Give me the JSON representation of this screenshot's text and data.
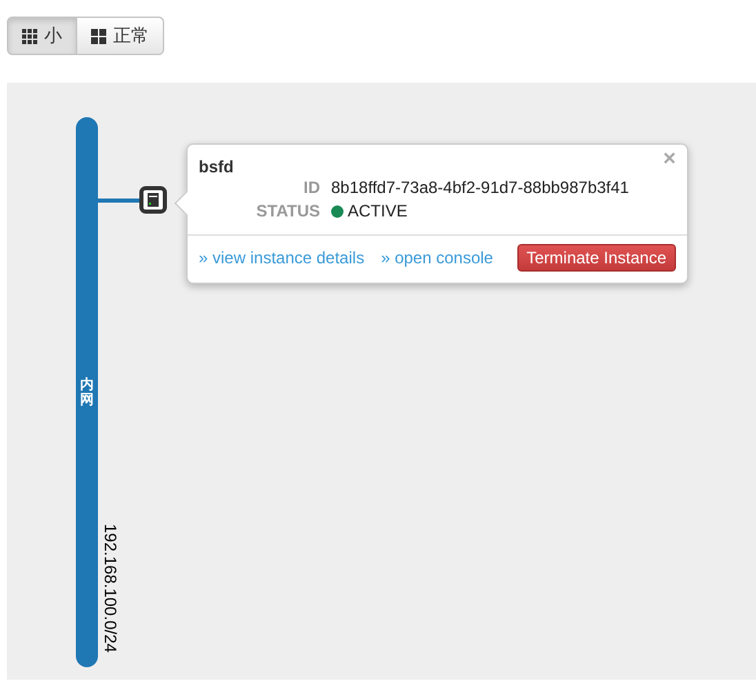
{
  "view_toggle": [
    {
      "label": "小",
      "selected": true,
      "kind": "small"
    },
    {
      "label": "正常",
      "selected": false,
      "kind": "normal"
    }
  ],
  "network": {
    "name": "内网",
    "cidr": "192.168.100.0/24"
  },
  "instance_popup": {
    "name": "bsfd",
    "close": "×",
    "fields": [
      {
        "label": "ID",
        "value": "8b18ffd7-73a8-4bf2-91d7-88bb987b3f41",
        "kind": "text"
      },
      {
        "label": "STATUS",
        "value": "ACTIVE",
        "kind": "status"
      }
    ],
    "links": [
      "» view instance details",
      "» open console"
    ],
    "button": "Terminate Instance"
  }
}
